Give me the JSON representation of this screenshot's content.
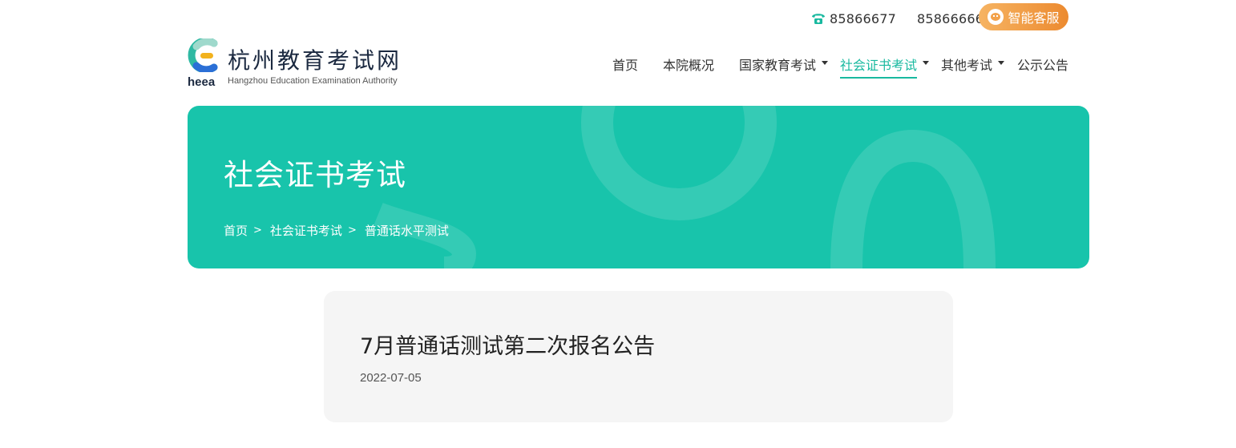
{
  "contact": {
    "phones": [
      "85866677",
      "85866666"
    ],
    "service_label": "智能客服"
  },
  "logo": {
    "name_cn": "杭州教育考试网",
    "abbr": "heea",
    "name_en": "Hangzhou Education Examination Authority"
  },
  "nav": {
    "items": [
      {
        "label": "首页"
      },
      {
        "label": "本院概况"
      },
      {
        "label": "国家教育考试"
      },
      {
        "label": "社会证书考试"
      },
      {
        "label": "其他考试"
      },
      {
        "label": "公示公告"
      }
    ]
  },
  "banner": {
    "title": "社会证书考试",
    "breadcrumb": [
      "首页",
      "社会证书考试",
      "普通话水平测试"
    ],
    "separator": ">"
  },
  "article": {
    "title": "7月普通话测试第二次报名公告",
    "date": "2022-07-05"
  },
  "colors": {
    "accent": "#18b99f",
    "banner": "#18c4ab",
    "service_start": "#f6b463",
    "service_end": "#ec8a2f"
  }
}
